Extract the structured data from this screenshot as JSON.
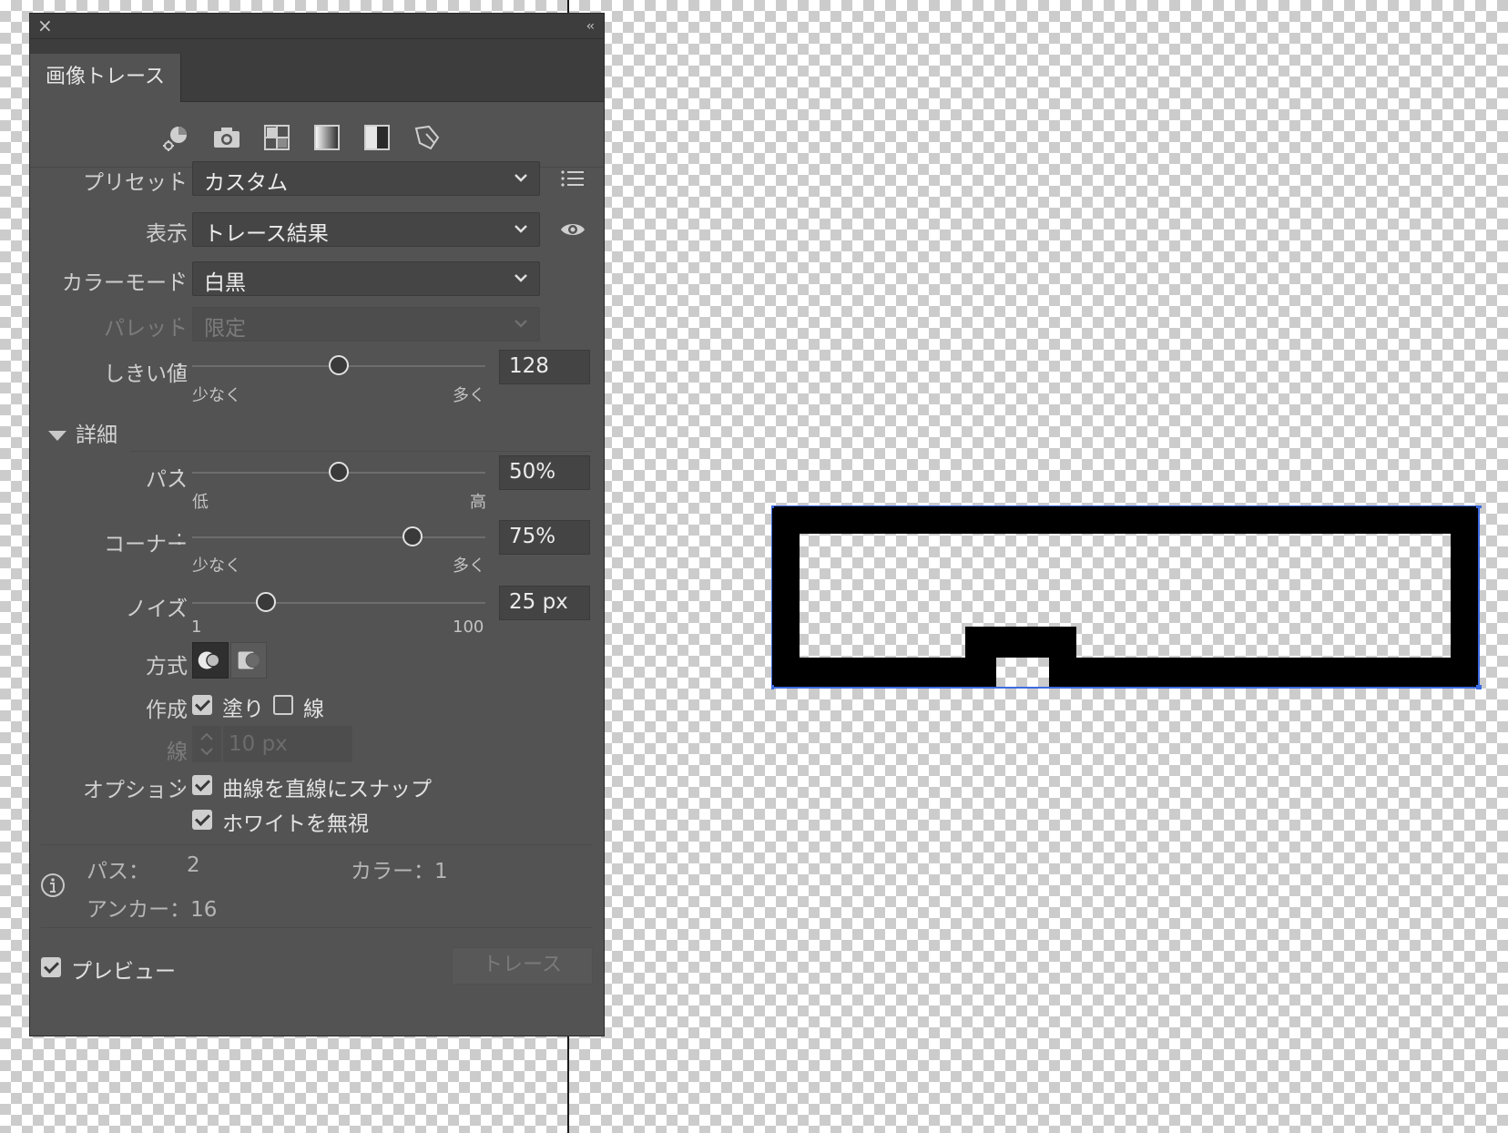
{
  "panel": {
    "title": "画像トレース",
    "close_glyph": "×",
    "collapse_glyph": "‹‹"
  },
  "preset_icons": [
    "auto-color-icon",
    "high-color-photo-icon",
    "low-color-icon",
    "grayscale-icon",
    "black-and-white-icon",
    "outline-icon"
  ],
  "preset": {
    "label": "プリセット",
    "value": "カスタム"
  },
  "view": {
    "label": "表示",
    "value": "トレース結果"
  },
  "mode": {
    "label": "カラーモード",
    "value": "白黒"
  },
  "palette": {
    "label": "パレット",
    "value": "限定"
  },
  "threshold": {
    "label": "しきい値",
    "value": "128",
    "level": 0.5,
    "min_label": "少なく",
    "max_label": "多く"
  },
  "advanced": {
    "label": "詳細"
  },
  "paths": {
    "label": "パス",
    "value": "50%",
    "level": 0.5,
    "min_label": "低",
    "max_label": "高"
  },
  "corners": {
    "label": "コーナー",
    "value": "75%",
    "level": 0.75,
    "min_label": "少なく",
    "max_label": "多く"
  },
  "noise": {
    "label": "ノイズ",
    "value": "25 px",
    "level": 0.25,
    "min_label": "1",
    "max_label": "100"
  },
  "method": {
    "label": "方式"
  },
  "create": {
    "label": "作成",
    "fills_label": "塗り",
    "fills_checked": true,
    "stroke_label": "線",
    "stroke_checked": false
  },
  "stroke": {
    "label": "線",
    "value": "10 px"
  },
  "options": {
    "label": "オプション",
    "snap_label": "曲線を直線にスナップ",
    "snap_checked": true,
    "ignore_white_label": "ホワイトを無視",
    "ignore_white_checked": true
  },
  "stats": {
    "paths_label": "パス：",
    "paths_value": "2",
    "colors_label": "カラー：1",
    "anchors_label": "アンカー：16"
  },
  "footer": {
    "preview_label": "プレビュー",
    "preview_checked": true,
    "trace_label": "トレース"
  },
  "colors": {
    "panel_bg": "#535353",
    "selection": "#3d6be0"
  }
}
